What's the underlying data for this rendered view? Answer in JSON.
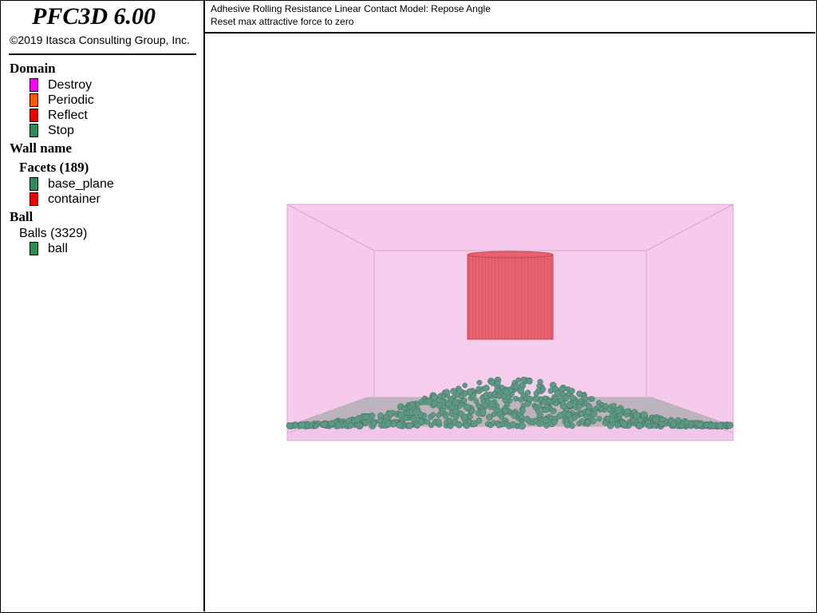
{
  "app": {
    "title": "PFC3D 6.00",
    "copyright": "©2019 Itasca Consulting Group, Inc."
  },
  "legend": {
    "domain": {
      "heading": "Domain",
      "items": [
        {
          "label": "Destroy",
          "color": "#ff00ff"
        },
        {
          "label": "Periodic",
          "color": "#ff5a00"
        },
        {
          "label": "Reflect",
          "color": "#ee0000"
        },
        {
          "label": "Stop",
          "color": "#2e8b57"
        }
      ]
    },
    "wall_name": {
      "heading": "Wall name",
      "facets_heading": "Facets (189)",
      "items": [
        {
          "label": "base_plane",
          "color": "#2e8b57"
        },
        {
          "label": "container",
          "color": "#ee0000"
        }
      ]
    },
    "ball": {
      "heading": "Ball",
      "balls_heading": "Balls (3329)",
      "items": [
        {
          "label": "ball",
          "color": "#2e8b57"
        }
      ]
    }
  },
  "header": {
    "line1": "Adhesive Rolling Resistance Linear Contact Model: Repose Angle",
    "line2": "Reset max attractive force to zero"
  },
  "scene": {
    "colors": {
      "domain_box": "#f2c6e8",
      "box_back": "#f7cdee",
      "box_edges": "#dba8cf",
      "cylinder": "#e8636f",
      "cylinder_stripes": "#c64451",
      "floor": "#b7b0b8",
      "balls": "#5f9985",
      "ball_outline": "#3e6e5d"
    }
  }
}
